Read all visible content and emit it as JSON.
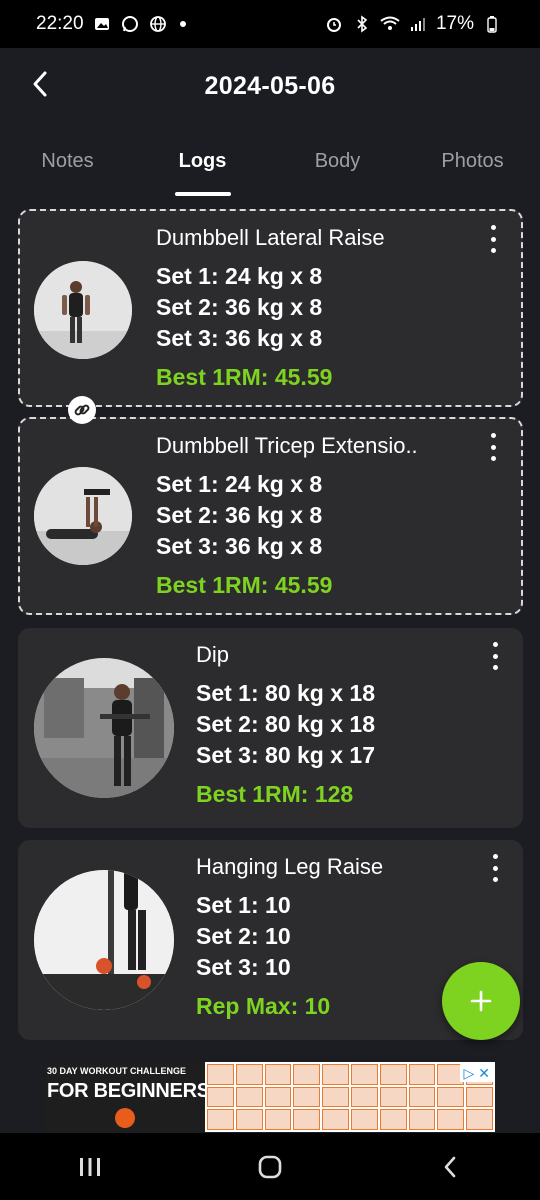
{
  "status_bar": {
    "time": "22:20",
    "battery": "17%",
    "left_icons": [
      "image-icon",
      "whatsapp-icon",
      "globe-icon"
    ],
    "right_icons": [
      "alarm-icon",
      "bluetooth-icon",
      "wifi-icon",
      "signal-icon",
      "battery-icon"
    ]
  },
  "header": {
    "title": "2024-05-06",
    "back_icon": "chevron-left-icon"
  },
  "tabs": [
    {
      "label": "Notes",
      "active": false
    },
    {
      "label": "Logs",
      "active": true
    },
    {
      "label": "Body",
      "active": false
    },
    {
      "label": "Photos",
      "active": false
    }
  ],
  "exercises": [
    {
      "name": "Dumbbell Lateral Raise",
      "sets": [
        "Set 1: 24 kg x 8",
        "Set 2: 36 kg x 8",
        "Set 3: 36 kg x 8"
      ],
      "best": "Best 1RM: 45.59",
      "superset": true
    },
    {
      "name": "Dumbbell Tricep Extensio..",
      "sets": [
        "Set 1: 24 kg x 8",
        "Set 2: 36 kg x 8",
        "Set 3: 36 kg x 8"
      ],
      "best": "Best 1RM: 45.59",
      "superset": true
    },
    {
      "name": "Dip",
      "sets": [
        "Set 1: 80 kg x 18",
        "Set 2: 80 kg x 18",
        "Set 3: 80 kg x 17"
      ],
      "best": "Best 1RM: 128",
      "superset": false
    },
    {
      "name": "Hanging Leg Raise",
      "sets": [
        "Set 1: 10",
        "Set 2: 10",
        "Set 3: 10"
      ],
      "best": "Rep Max: 10",
      "superset": false
    }
  ],
  "superset_link_icon": "link-icon",
  "fab": {
    "icon": "plus-icon"
  },
  "ad": {
    "headline": "30 DAY WORKOUT CHALLENGE",
    "subline": "FOR BEGINNERS",
    "adchoices_icon": "adchoices-icon",
    "close_icon": "close-icon"
  },
  "nav_bar": {
    "icons": [
      "recent-apps-icon",
      "home-icon",
      "back-icon"
    ]
  },
  "colors": {
    "accent": "#7ed321",
    "card": "#2c2c2e",
    "background": "#1b1d22"
  }
}
